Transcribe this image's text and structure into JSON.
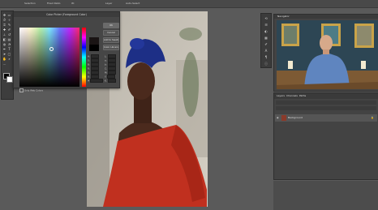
{
  "topbar": {
    "items": [
      "Selection",
      "Fixed Ratio",
      "W:",
      "Layer",
      "Auto-Select"
    ]
  },
  "toolbar": {
    "tools": [
      "move-icon",
      "marquee-icon",
      "lasso-icon",
      "magic-wand-icon",
      "crop-icon",
      "eyedropper-icon",
      "healing-icon",
      "brush-icon",
      "stamp-icon",
      "history-brush-icon",
      "eraser-icon",
      "gradient-icon",
      "blur-icon",
      "dodge-icon",
      "pen-icon",
      "type-icon",
      "path-select-icon",
      "shape-icon",
      "hand-icon",
      "zoom-icon"
    ]
  },
  "color_picker": {
    "title": "Color Picker (Foreground Color)",
    "ok_label": "OK",
    "cancel_label": "Cancel",
    "add_swatch_label": "Add to Swatches",
    "libraries_label": "Color Libraries",
    "only_web_colors_label": "Only Web Colors",
    "new_color": "#1a1414",
    "current_color": "#000000",
    "fields": [
      "H:",
      "S:",
      "B:",
      "R:",
      "G:",
      "B:",
      "L:",
      "a:",
      "b:",
      "C:",
      "M:",
      "Y:",
      "K:",
      "#"
    ]
  },
  "navigator": {
    "tab_label": "Navigator"
  },
  "layers": {
    "tabs": [
      "Layers",
      "Channels",
      "Paths"
    ],
    "layer_name": "Background"
  },
  "colors": {
    "dress_red": "#c0301f",
    "headwrap_blue": "#1d2f86",
    "skin": "#4b2a1d",
    "background": "#c8c2b6"
  }
}
